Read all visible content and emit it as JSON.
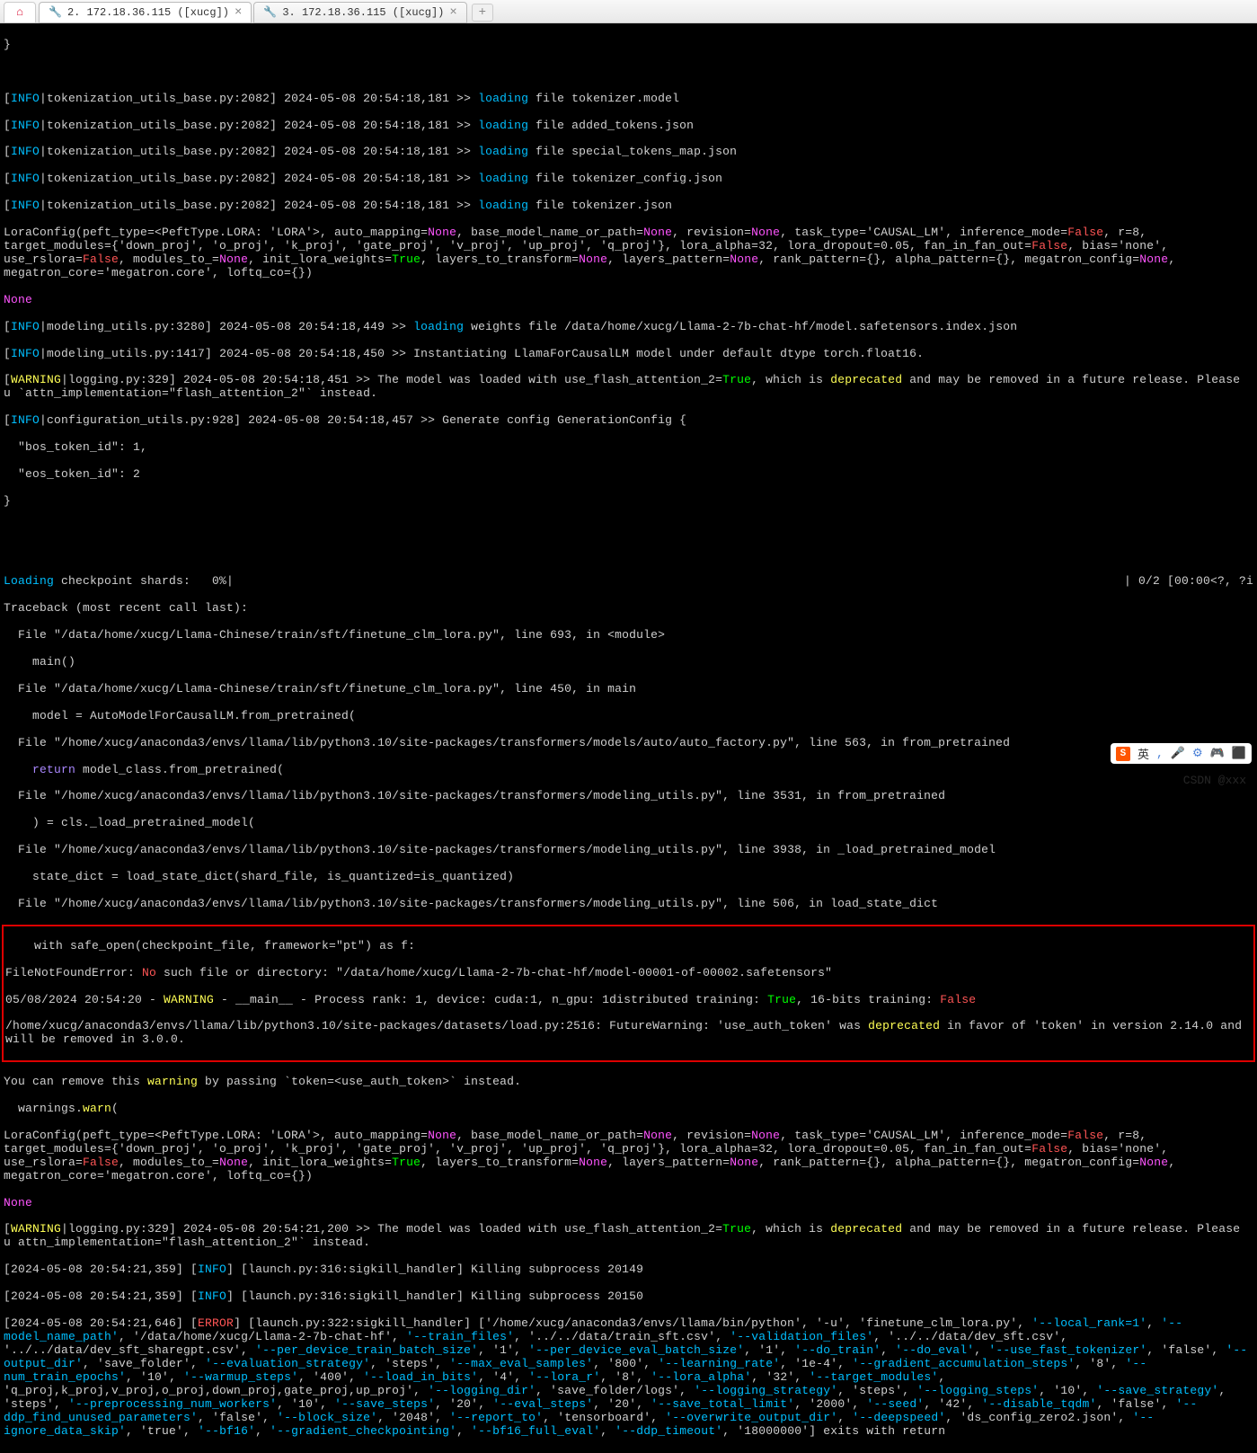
{
  "tabs": {
    "home_icon": "⌂",
    "items": [
      {
        "icon": "🔧",
        "label": "2. 172.18.36.115 ([xucg])",
        "active": true
      },
      {
        "icon": "🔧",
        "label": "3. 172.18.36.115 ([xucg])",
        "active": false
      }
    ],
    "close": "×",
    "new": "+"
  },
  "log": {
    "brace_close": "}",
    "info_lines": [
      {
        "pre": "[",
        "tag": "INFO",
        "post": "|tokenization_utils_base.py:2082] 2024-05-08 20:54:18,181 >> ",
        "kw": "loading",
        "rest": " file tokenizer.model"
      },
      {
        "pre": "[",
        "tag": "INFO",
        "post": "|tokenization_utils_base.py:2082] 2024-05-08 20:54:18,181 >> ",
        "kw": "loading",
        "rest": " file added_tokens.json"
      },
      {
        "pre": "[",
        "tag": "INFO",
        "post": "|tokenization_utils_base.py:2082] 2024-05-08 20:54:18,181 >> ",
        "kw": "loading",
        "rest": " file special_tokens_map.json"
      },
      {
        "pre": "[",
        "tag": "INFO",
        "post": "|tokenization_utils_base.py:2082] 2024-05-08 20:54:18,181 >> ",
        "kw": "loading",
        "rest": " file tokenizer_config.json"
      },
      {
        "pre": "[",
        "tag": "INFO",
        "post": "|tokenization_utils_base.py:2082] 2024-05-08 20:54:18,181 >> ",
        "kw": "loading",
        "rest": " file tokenizer.json"
      }
    ],
    "lora1": {
      "a": "LoraConfig(peft_type=<PeftType.LORA: 'LORA'>, auto_mapping=",
      "none1": "None",
      "b": ", base_model_name_or_path=",
      "none2": "None",
      "c": ", revision=",
      "none3": "None",
      "d": ", task_type='CAUSAL_LM', inference_mode=",
      "false1": "False",
      "e": ", r=8, target_modules={'down_proj', 'o_proj', 'k_proj', 'gate_proj', 'v_proj', 'up_proj', 'q_proj'}, lora_alpha=32, lora_dropout=0.05, fan_in_fan_out=",
      "false2": "False",
      "f": ", bias='none', use_rslora=",
      "false3": "False",
      "g": ", modules_to_=",
      "none4": "None",
      "h": ", init_lora_weights=",
      "true1": "True",
      "i": ", layers_to_transform=",
      "none5": "None",
      "j": ", layers_pattern=",
      "none6": "None",
      "k": ", rank_pattern={}, alpha_pattern={}, megatron_config=",
      "none7": "None",
      "l": ", megatron_core='megatron.core', loftq_co={})"
    },
    "none_lone": "None",
    "info_model": {
      "pre": "[",
      "tag": "INFO",
      "post": "|modeling_utils.py:3280] 2024-05-08 20:54:18,449 >> ",
      "kw": "loading",
      "rest": " weights file /data/home/xucg/Llama-2-7b-chat-hf/model.safetensors.index.json"
    },
    "info_inst": {
      "pre": "[",
      "tag": "INFO",
      "post": "|modeling_utils.py:1417] 2024-05-08 20:54:18,450 >> Instantiating LlamaForCausalLM model under default dtype torch.float16."
    },
    "warn1": {
      "pre": "[",
      "tag": "WARNING",
      "post": "|logging.py:329] 2024-05-08 20:54:18,451 >> The model was loaded with use_flash_attention_2=",
      "true": "True",
      "mid": ", which is ",
      "dep": "deprecated",
      "rest": " and may be removed in a future release. Please u `attn_implementation=\"flash_attention_2\"` instead."
    },
    "info_gen": {
      "pre": "[",
      "tag": "INFO",
      "post": "|configuration_utils.py:928] 2024-05-08 20:54:18,457 >> Generate config GenerationConfig {"
    },
    "gen_bos": "  \"bos_token_id\": 1,",
    "gen_eos": "  \"eos_token_id\": 2",
    "loading_ck": {
      "a": "Loading",
      "b": " checkpoint shards:   0%|",
      "right": "| 0/2 [00:00<?, ?i"
    },
    "traceback": "Traceback (most recent call last):",
    "tb": [
      "  File \"/data/home/xucg/Llama-Chinese/train/sft/finetune_clm_lora.py\", line 693, in <module>",
      "    main()",
      "  File \"/data/home/xucg/Llama-Chinese/train/sft/finetune_clm_lora.py\", line 450, in main",
      "    model = AutoModelForCausalLM.from_pretrained(",
      "  File \"/home/xucg/anaconda3/envs/llama/lib/python3.10/site-packages/transformers/models/auto/auto_factory.py\", line 563, in from_pretrained",
      "  File \"/home/xucg/anaconda3/envs/llama/lib/python3.10/site-packages/transformers/modeling_utils.py\", line 3531, in from_pretrained",
      "    ) = cls._load_pretrained_model(",
      "  File \"/home/xucg/anaconda3/envs/llama/lib/python3.10/site-packages/transformers/modeling_utils.py\", line 3938, in _load_pretrained_model",
      "    state_dict = load_state_dict(shard_file, is_quantized=is_quantized)",
      "  File \"/home/xucg/anaconda3/envs/llama/lib/python3.10/site-packages/transformers/modeling_utils.py\", line 506, in load_state_dict",
      "    with safe_open(checkpoint_file, framework=\"pt\") as f:"
    ],
    "return_line": {
      "a": "    ",
      "kw": "return",
      "b": " model_class.from_pretrained("
    },
    "fnf": {
      "a": "FileNotFoundError: ",
      "no": "No",
      "b": " such file or directory: \"/data/home/xucg/Llama-2-7b-chat-hf/model-00001-of-00002.safetensors\""
    },
    "proc": {
      "a": "05/08/2024 20:54:20 - ",
      "w": "WARNING",
      "b": " - __main__ - Process rank: 1, device: cuda:1, n_gpu: 1distributed training: ",
      "t": "True",
      "c": ", 16-bits training: ",
      "f": "False"
    },
    "fut": {
      "a": "/home/xucg/anaconda3/envs/llama/lib/python3.10/site-packages/datasets/load.py:2516: FutureWarning: 'use_auth_token' was ",
      "dep": "deprecated",
      "b": " in favor of 'token' in version 2.14.0 and will be removed in 3.0.0."
    },
    "remove": {
      "a": "You can remove this ",
      "w": "warning",
      "b": " by passing `token=<use_auth_token>` instead."
    },
    "warn_fn": {
      "a": "  warnings.",
      "w": "warn",
      "b": "("
    },
    "warn2": {
      "pre": "[",
      "tag": "WARNING",
      "post": "|logging.py:329] 2024-05-08 20:54:21,200 >> The model was loaded with use_flash_attention_2=",
      "true": "True",
      "mid": ", which is ",
      "dep": "deprecated",
      "rest": " and may be removed in a future release. Please u attn_implementation=\"flash_attention_2\"` instead."
    },
    "kill1": {
      "a": "[2024-05-08 20:54:21,359] [",
      "tag": "INFO",
      "b": "] [launch.py:316:sigkill_handler] Killing subprocess 20149"
    },
    "kill2": {
      "a": "[2024-05-08 20:54:21,359] [",
      "tag": "INFO",
      "b": "] [launch.py:316:sigkill_handler] Killing subprocess 20150"
    },
    "errl": {
      "a": "[2024-05-08 20:54:21,646] [",
      "tag": "ERROR",
      "b": "] [launch.py:322:sigkill_handler] ['/home/xucg/anaconda3/envs/llama/bin/python', '-u', 'finetune_clm_lora.py', "
    },
    "args": {
      "flags": [
        "'--local_rank=1'",
        "'--model_name_path'",
        "'/data/home/xucg/Llama-2-7b-chat-hf'",
        "'--train_files'",
        "'../../data/train_sft.csv'",
        "'--validation_files'",
        "'../../data/dev_sft.csv'",
        "'../../data/dev_sft_sharegpt.csv'",
        "'--per_device_train_batch_size'",
        "'1'",
        "'--per_device_eval_batch_size'",
        "'1'",
        "'--do_train'",
        "'--do_eval'",
        "'--use_fast_tokenizer'",
        "'false'",
        "'--output_dir'",
        "'save_folder'",
        "'--evaluation_strategy'",
        "'steps'",
        "'--max_eval_samples'",
        "'800'",
        "'--learning_rate'",
        "'1e-4'",
        "'--gradient_accumulation_steps'",
        "'8'",
        "'--num_train_epochs'",
        "'10'",
        "'--warmup_steps'",
        "'400'",
        "'--load_in_bits'",
        "'4'",
        "'--lora_r'",
        "'8'",
        "'--lora_alpha'",
        "'32'",
        "'--target_modules'",
        "'q_proj,k_proj,v_proj,o_proj,down_proj,gate_proj,up_proj'",
        "'--logging_dir'",
        "'save_folder/logs'",
        "'--logging_strategy'",
        "'steps'",
        "'--logging_steps'",
        "'10'",
        "'--save_strategy'",
        "'steps'",
        "'--preprocessing_num_workers'",
        "'10'",
        "'--save_steps'",
        "'20'",
        "'--eval_steps'",
        "'20'",
        "'--save_total_limit'",
        "'2000'",
        "'--seed'",
        "'42'",
        "'--disable_tqdm'",
        "'false'",
        "'--ddp_find_unused_parameters'",
        "'false'",
        "'--block_size'",
        "'2048'",
        "'--report_to'",
        "'tensorboard'",
        "'--overwrite_output_dir'",
        "'--deepspeed'",
        "'ds_config_zero2.json'",
        "'--ignore_data_skip'",
        "'true'",
        "'--bf16'",
        "'--gradient_checkpointing'",
        "'--bf16_full_eval'",
        "'--ddp_timeout'",
        "'18000000'"
      ],
      "tail": "] exits with return"
    }
  },
  "ime": {
    "logo": "S",
    "text": "英",
    "icons": [
      ",",
      "🎤",
      "⚙",
      "🎮",
      "⬛"
    ]
  },
  "watermark": "CSDN @xxx"
}
